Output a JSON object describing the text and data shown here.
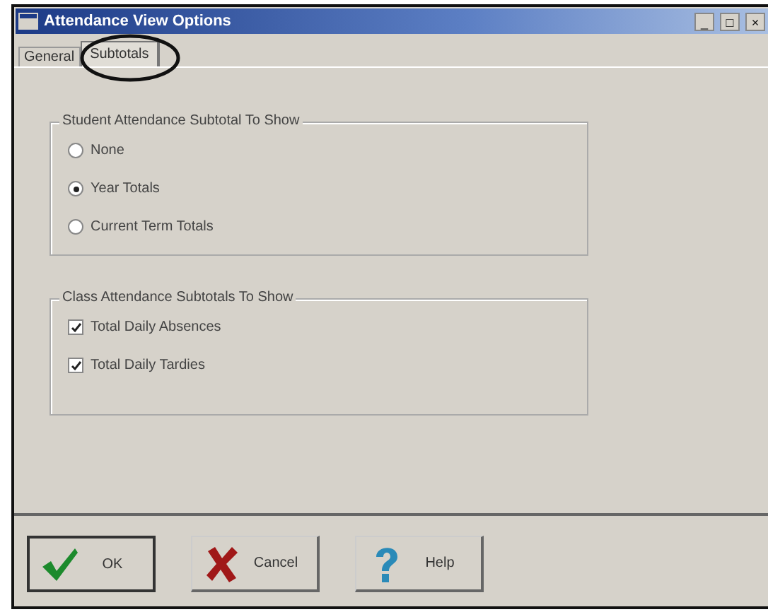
{
  "window": {
    "title": "Attendance View Options",
    "controls": [
      "_",
      "□",
      "×"
    ]
  },
  "tabs": [
    {
      "label": "General",
      "selected": false
    },
    {
      "label": "Subtotals",
      "selected": true
    }
  ],
  "groups": [
    {
      "title": "Student Attendance Subtotal To Show",
      "kind": "radio",
      "items": [
        {
          "label": "None",
          "selected": false
        },
        {
          "label": "Year Totals",
          "selected": true
        },
        {
          "label": "Current Term Totals",
          "selected": false
        }
      ]
    },
    {
      "title": "Class Attendance Subtotals To Show",
      "kind": "checkbox",
      "items": [
        {
          "label": "Total Daily Absences",
          "checked": true
        },
        {
          "label": "Total Daily Tardies",
          "checked": true
        }
      ]
    }
  ],
  "buttons": [
    {
      "label": "OK",
      "kind": "ok"
    },
    {
      "label": "Cancel",
      "kind": "cancel"
    },
    {
      "label": "Help",
      "kind": "help"
    }
  ]
}
